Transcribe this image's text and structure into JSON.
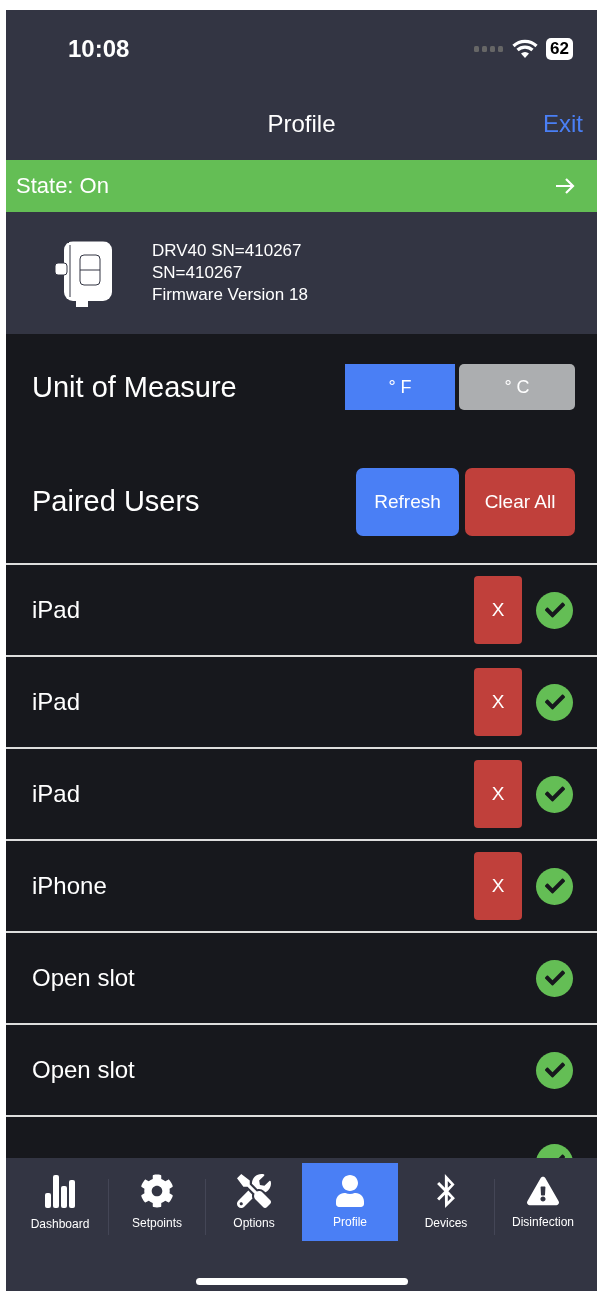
{
  "status_bar": {
    "time": "10:08",
    "battery": "62"
  },
  "header": {
    "title": "Profile",
    "exit": "Exit"
  },
  "state_banner": {
    "label": "State: On"
  },
  "device": {
    "lines": [
      "DRV40 SN=410267",
      "SN=410267",
      "Firmware Version 18"
    ]
  },
  "unit_of_measure": {
    "label": "Unit of Measure",
    "options": [
      {
        "label": "° F",
        "selected": true
      },
      {
        "label": "° C",
        "selected": false
      }
    ]
  },
  "paired_users": {
    "label": "Paired Users",
    "refresh": "Refresh",
    "clear_all": "Clear All",
    "users": [
      {
        "name": "iPad",
        "kind": "user",
        "remove": "X"
      },
      {
        "name": "iPad",
        "kind": "user",
        "remove": "X"
      },
      {
        "name": "iPad",
        "kind": "user",
        "remove": "X"
      },
      {
        "name": "iPhone",
        "kind": "user",
        "remove": "X"
      },
      {
        "name": "Open slot",
        "kind": "open"
      },
      {
        "name": "Open slot",
        "kind": "open"
      },
      {
        "kind": "open"
      }
    ]
  },
  "tabs": [
    {
      "label": "Dashboard",
      "kind": "dashboard",
      "selected": false
    },
    {
      "label": "Setpoints",
      "kind": "setpoints",
      "selected": false
    },
    {
      "label": "Options",
      "kind": "options",
      "selected": false
    },
    {
      "label": "Profile",
      "kind": "profile",
      "selected": true
    },
    {
      "label": "Devices",
      "kind": "devices",
      "selected": false
    },
    {
      "label": "Disinfection",
      "kind": "disinfection",
      "selected": false
    }
  ]
}
